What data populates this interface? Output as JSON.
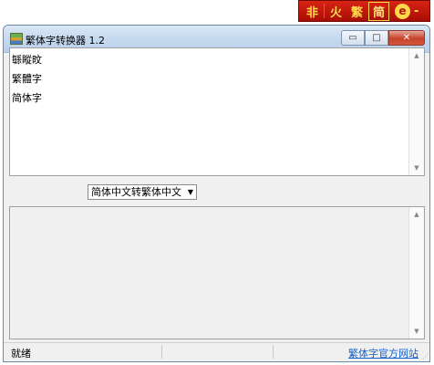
{
  "badge": {
    "chars": [
      "非",
      "火",
      "繁",
      "简"
    ],
    "ie_glyph": "e",
    "dash": "-"
  },
  "window": {
    "title": "繁体字转换器 1.2",
    "buttons": {
      "minimize": "▭",
      "maximize": "□",
      "close": "✕"
    }
  },
  "input": {
    "lines": [
      "緐瞛旼",
      "繁體字",
      "简体字"
    ]
  },
  "mode_select": {
    "selected": "简体中文转繁体中文"
  },
  "status": {
    "text": "就绪",
    "link": "繁体字官方网站"
  },
  "colors": {
    "badge_red": "#c41a0c",
    "badge_gold": "#ffd84a",
    "link_blue": "#1560d0"
  }
}
